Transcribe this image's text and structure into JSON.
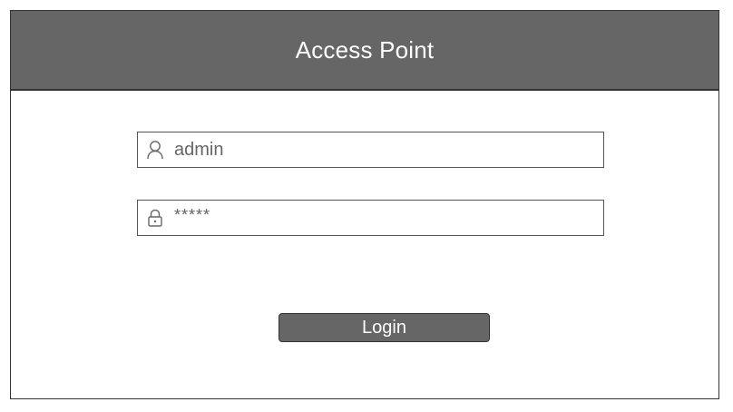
{
  "header": {
    "title": "Access Point"
  },
  "form": {
    "username": {
      "value": "admin",
      "icon": "user-icon"
    },
    "password": {
      "value": "*****",
      "icon": "lock-icon"
    },
    "login_label": "Login"
  },
  "colors": {
    "header_bg": "#666666",
    "button_bg": "#666666",
    "border": "#333333",
    "text": "#666666"
  }
}
